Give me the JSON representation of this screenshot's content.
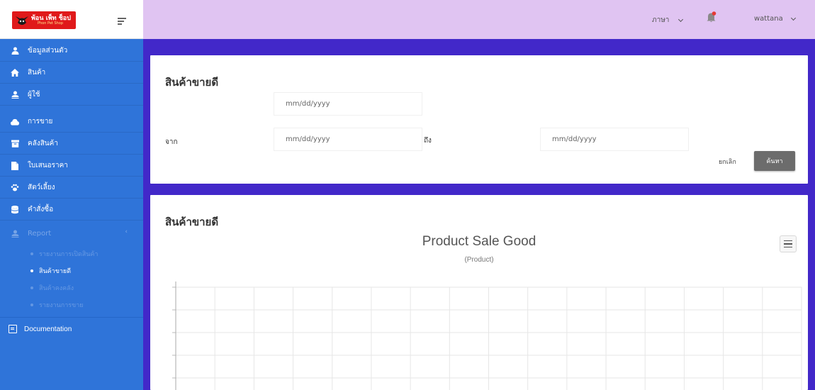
{
  "brand": {
    "name": "พ้อน เพ็ท ช็อป",
    "sub": "Phon Pet Shop"
  },
  "sidebar": {
    "items": [
      {
        "label": "ข้อมูลส่วนตัว",
        "icon": "user-icon"
      },
      {
        "label": "สินค้า",
        "icon": "home-icon"
      },
      {
        "label": "ผู้ใช้",
        "icon": "user-icon"
      },
      {
        "label": "การขาย",
        "icon": "cloud-icon"
      },
      {
        "label": "คลังสินค้า",
        "icon": "archive-icon"
      },
      {
        "label": "ใบเสนอราคา",
        "icon": "file-icon"
      },
      {
        "label": "สัตว์เลี้ยง",
        "icon": "paw-icon"
      },
      {
        "label": "คำสั่งซื้อ",
        "icon": "database-icon"
      }
    ],
    "report": {
      "label": "Report",
      "icon": "user-icon",
      "subitems": [
        "รายงานการเปิดสินค้า",
        "สินค้าขายดี",
        "สินค้าคงคลัง",
        "รายงานการขาย"
      ]
    },
    "documentation": "Documentation"
  },
  "topbar": {
    "language": "ภาษา",
    "username": "wattana"
  },
  "filter_card": {
    "title": "สินค้าขายดี",
    "top_date_placeholder": "mm/dd/yyyy",
    "from_label": "จาก",
    "from_placeholder": "mm/dd/yyyy",
    "to_label": "ถึง",
    "to_placeholder": "mm/dd/yyyy",
    "cancel_label": "ยกเลิก",
    "search_label": "ค้นหา"
  },
  "chart_card": {
    "title": "สินค้าขายดี"
  },
  "chart_data": {
    "type": "bar",
    "title": "Product Sale Good",
    "subtitle": "(Product)",
    "categories": [],
    "series": [],
    "grid": true,
    "grid_columns": 16
  },
  "colors": {
    "sidebar": "#2f74d9",
    "topbar": "#e0c4f2",
    "main_bg": "#4228c9",
    "search_button": "#6c6c6c",
    "logo": "#e0191a"
  }
}
